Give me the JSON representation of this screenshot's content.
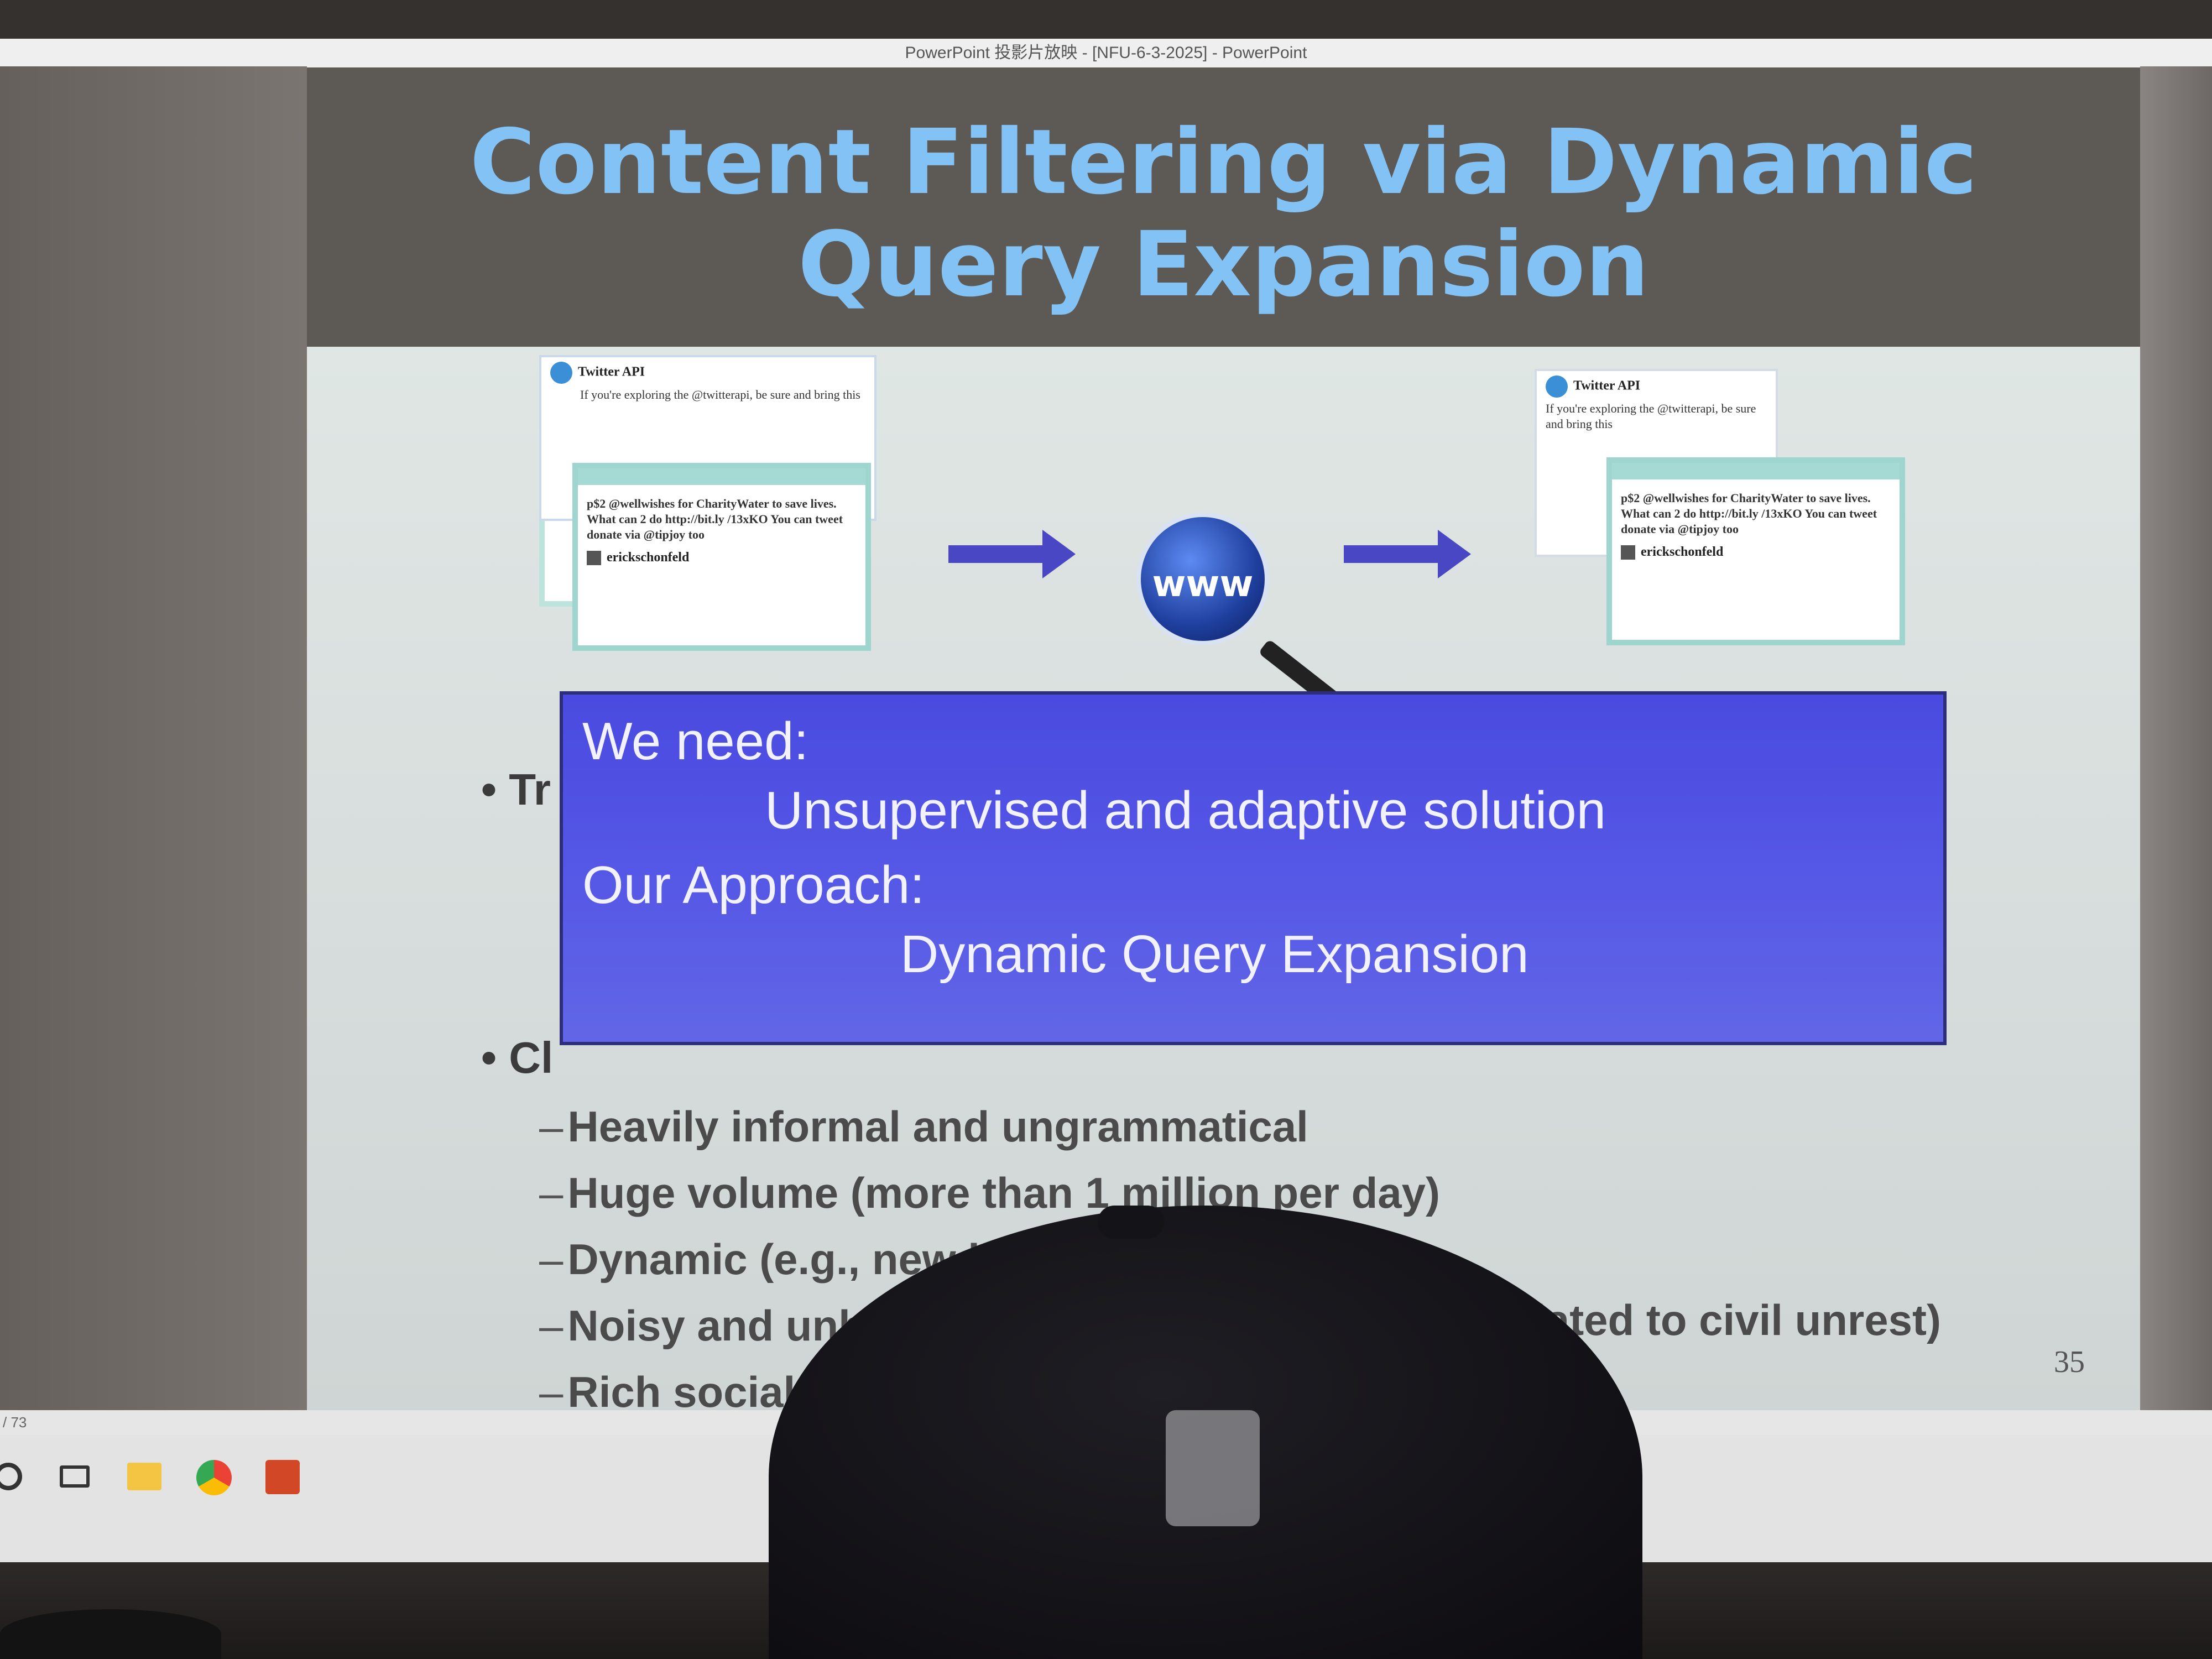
{
  "window": {
    "title": "PowerPoint 投影片放映 - [NFU-6-3-2025] - PowerPoint"
  },
  "slide": {
    "title_line1": "Content Filtering via Dynamic",
    "title_line2": "Query Expansion",
    "collage": {
      "left_card_label": "twitter",
      "left_card_user": "Twitter API",
      "left_card_text": "If you're exploring the @twitterapi, be sure and bring this",
      "main_card_text": "p$2 @wellwishes for CharityWater to save lives. What can 2 do http://bit.ly /13xKO You can tweet donate via @tipjoy too",
      "main_card_user": "erickschonfeld",
      "globe_label": "www",
      "right_card_user": "Twitter API",
      "right_card_text": "If you're exploring the @twitterapi, be sure and bring this",
      "right_card_text2": "p$2 @wellwishes for CharityWater to save lives. What can 2 do http://bit.ly /13xKO You can tweet donate via @tipjoy too",
      "right_card_user2": "erickschonfeld"
    },
    "bullets": {
      "bullet1_fragment": "Tr",
      "bullet2_fragment": "Cl",
      "subs": [
        "Heavily informal and ungrammatical",
        "Huge volume (more than 1 million per day)",
        "Dynamic (e.g., new hashtags, new topics)",
        "Noisy and unbalanced",
        "5% related to civil unrest)",
        "Rich social ne"
      ]
    },
    "number": "35"
  },
  "overlay": {
    "line1": "We need:",
    "line2": "Unsupervised and adaptive solution",
    "line3": "Our Approach:",
    "line4": "Dynamic Query Expansion"
  },
  "status": {
    "slide_counter": "/ 73"
  },
  "icons": [
    "search-icon",
    "task-view-icon",
    "file-explorer-icon",
    "chrome-icon",
    "powerpoint-icon"
  ]
}
